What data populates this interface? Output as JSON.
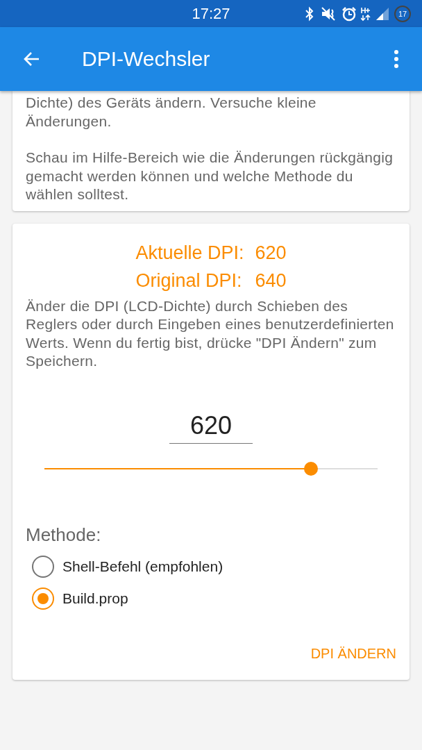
{
  "status_bar": {
    "time": "17:27",
    "battery_level_text": "17"
  },
  "app_bar": {
    "title": "DPI-Wechsler"
  },
  "info_card": {
    "paragraphs": [
      "Dichte) des Geräts ändern. Versuche kleine Änderungen.",
      "Schau im Hilfe-Bereich wie die Änderungen rückgängig gemacht werden können und welche Methode du wählen solltest."
    ]
  },
  "dpi_card": {
    "current_label": "Aktuelle DPI:",
    "current_value": "620",
    "original_label": "Original DPI:",
    "original_value": "640",
    "description": "Änder die DPI (LCD-Dichte) durch Schieben des Reglers oder durch Eingeben eines benutzerdefinierten Werts. Wenn du fertig bist, drücke \"DPI Ändern\" zum Speichern.",
    "dpi_input": {
      "value": "620"
    },
    "slider": {
      "level": 0.8
    },
    "method_label": "Methode:",
    "methods": [
      {
        "label": "Shell-Befehl (empfohlen)",
        "selected": false
      },
      {
        "label": "Build.prop",
        "selected": true
      }
    ],
    "action_button": "DPI ÄNDERN"
  }
}
